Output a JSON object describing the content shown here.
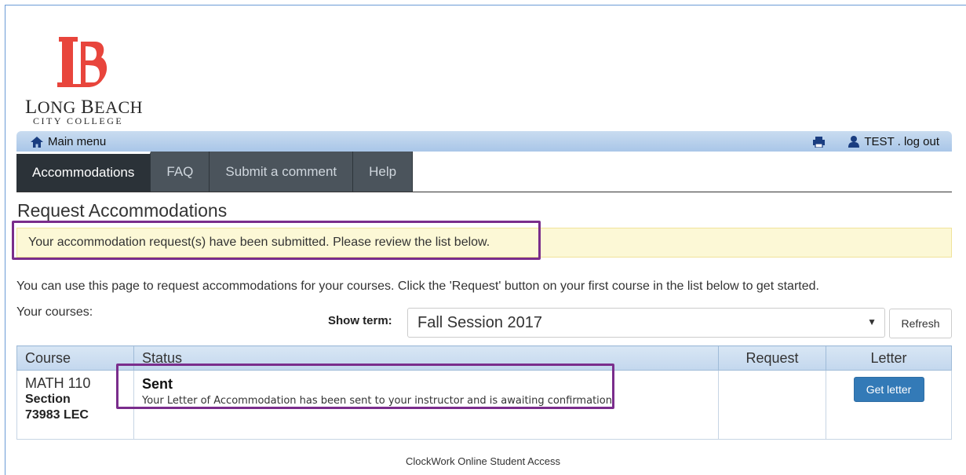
{
  "logo": {
    "line1_first": "L",
    "line1_rest": "ONG ",
    "line1_b": "B",
    "line1_rest2": "EACH",
    "line2": "CITY COLLEGE"
  },
  "topbar": {
    "main_menu": "Main menu",
    "user_text": "TEST . log out"
  },
  "tabs": [
    {
      "label": "Accommodations"
    },
    {
      "label": "FAQ"
    },
    {
      "label": "Submit a comment"
    },
    {
      "label": "Help"
    }
  ],
  "page": {
    "title": "Request Accommodations",
    "alert": "Your accommodation request(s) have been submitted. Please review the list below.",
    "intro": "You can use this page to request accommodations for your courses. Click the 'Request' button on your first course in the list below to get started.",
    "your_courses": "Your courses:",
    "show_term_label": "Show term:",
    "term_selected": "Fall Session 2017",
    "refresh": "Refresh"
  },
  "table": {
    "headers": [
      "Course",
      "Status",
      "Request",
      "Letter"
    ],
    "rows": [
      {
        "course": "MATH 110",
        "section_label": "Section",
        "section_num": "73983 LEC",
        "status_title": "Sent",
        "status_desc": "Your Letter of Accommodation has been sent to your instructor and is awaiting confirmation.",
        "request": "",
        "letter_button": "Get letter"
      }
    ]
  },
  "footer": "ClockWork Online Student Access",
  "colors": {
    "accent": "#337ab7",
    "highlight": "#7a2d8c",
    "logo_red": "#e8453c"
  }
}
